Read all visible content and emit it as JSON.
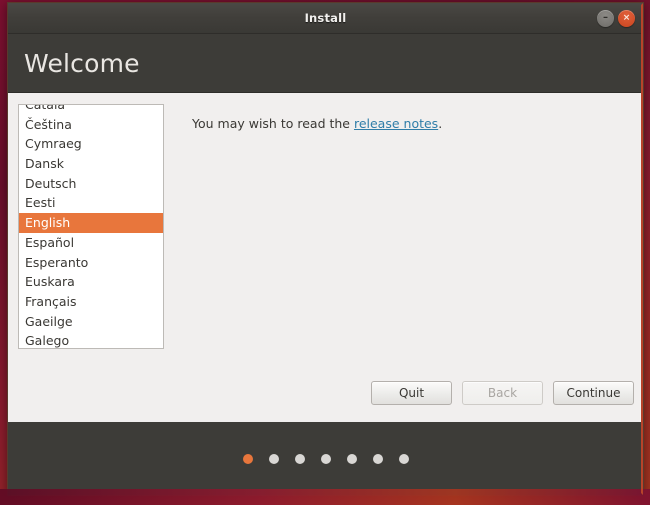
{
  "window": {
    "title": "Install",
    "controls": {
      "minimize_icon": "minimize-icon",
      "minimize_glyph": "–",
      "close_icon": "close-icon",
      "close_glyph": "×"
    }
  },
  "header": {
    "page_title": "Welcome"
  },
  "language_list": {
    "selected": "English",
    "items": [
      {
        "label": "Català",
        "selected": false
      },
      {
        "label": "Čeština",
        "selected": false
      },
      {
        "label": "Cymraeg",
        "selected": false
      },
      {
        "label": "Dansk",
        "selected": false
      },
      {
        "label": "Deutsch",
        "selected": false
      },
      {
        "label": "Eesti",
        "selected": false
      },
      {
        "label": "English",
        "selected": true
      },
      {
        "label": "Español",
        "selected": false
      },
      {
        "label": "Esperanto",
        "selected": false
      },
      {
        "label": "Euskara",
        "selected": false
      },
      {
        "label": "Français",
        "selected": false
      },
      {
        "label": "Gaeilge",
        "selected": false
      },
      {
        "label": "Galego",
        "selected": false
      }
    ]
  },
  "main": {
    "note_prefix": "You may wish to read the ",
    "note_link": "release notes",
    "note_suffix": "."
  },
  "buttons": {
    "quit": "Quit",
    "back": "Back",
    "continue": "Continue"
  },
  "progress": {
    "total": 7,
    "active_index": 0,
    "active_color": "#e8763c",
    "inactive_color": "#d9d7d4"
  }
}
